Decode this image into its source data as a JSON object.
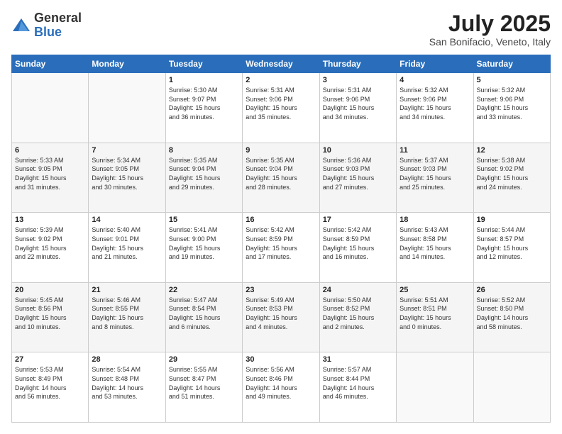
{
  "logo": {
    "general": "General",
    "blue": "Blue"
  },
  "header": {
    "month": "July 2025",
    "location": "San Bonifacio, Veneto, Italy"
  },
  "days_of_week": [
    "Sunday",
    "Monday",
    "Tuesday",
    "Wednesday",
    "Thursday",
    "Friday",
    "Saturday"
  ],
  "weeks": [
    [
      {
        "day": "",
        "info": ""
      },
      {
        "day": "",
        "info": ""
      },
      {
        "day": "1",
        "info": "Sunrise: 5:30 AM\nSunset: 9:07 PM\nDaylight: 15 hours\nand 36 minutes."
      },
      {
        "day": "2",
        "info": "Sunrise: 5:31 AM\nSunset: 9:06 PM\nDaylight: 15 hours\nand 35 minutes."
      },
      {
        "day": "3",
        "info": "Sunrise: 5:31 AM\nSunset: 9:06 PM\nDaylight: 15 hours\nand 34 minutes."
      },
      {
        "day": "4",
        "info": "Sunrise: 5:32 AM\nSunset: 9:06 PM\nDaylight: 15 hours\nand 34 minutes."
      },
      {
        "day": "5",
        "info": "Sunrise: 5:32 AM\nSunset: 9:06 PM\nDaylight: 15 hours\nand 33 minutes."
      }
    ],
    [
      {
        "day": "6",
        "info": "Sunrise: 5:33 AM\nSunset: 9:05 PM\nDaylight: 15 hours\nand 31 minutes."
      },
      {
        "day": "7",
        "info": "Sunrise: 5:34 AM\nSunset: 9:05 PM\nDaylight: 15 hours\nand 30 minutes."
      },
      {
        "day": "8",
        "info": "Sunrise: 5:35 AM\nSunset: 9:04 PM\nDaylight: 15 hours\nand 29 minutes."
      },
      {
        "day": "9",
        "info": "Sunrise: 5:35 AM\nSunset: 9:04 PM\nDaylight: 15 hours\nand 28 minutes."
      },
      {
        "day": "10",
        "info": "Sunrise: 5:36 AM\nSunset: 9:03 PM\nDaylight: 15 hours\nand 27 minutes."
      },
      {
        "day": "11",
        "info": "Sunrise: 5:37 AM\nSunset: 9:03 PM\nDaylight: 15 hours\nand 25 minutes."
      },
      {
        "day": "12",
        "info": "Sunrise: 5:38 AM\nSunset: 9:02 PM\nDaylight: 15 hours\nand 24 minutes."
      }
    ],
    [
      {
        "day": "13",
        "info": "Sunrise: 5:39 AM\nSunset: 9:02 PM\nDaylight: 15 hours\nand 22 minutes."
      },
      {
        "day": "14",
        "info": "Sunrise: 5:40 AM\nSunset: 9:01 PM\nDaylight: 15 hours\nand 21 minutes."
      },
      {
        "day": "15",
        "info": "Sunrise: 5:41 AM\nSunset: 9:00 PM\nDaylight: 15 hours\nand 19 minutes."
      },
      {
        "day": "16",
        "info": "Sunrise: 5:42 AM\nSunset: 8:59 PM\nDaylight: 15 hours\nand 17 minutes."
      },
      {
        "day": "17",
        "info": "Sunrise: 5:42 AM\nSunset: 8:59 PM\nDaylight: 15 hours\nand 16 minutes."
      },
      {
        "day": "18",
        "info": "Sunrise: 5:43 AM\nSunset: 8:58 PM\nDaylight: 15 hours\nand 14 minutes."
      },
      {
        "day": "19",
        "info": "Sunrise: 5:44 AM\nSunset: 8:57 PM\nDaylight: 15 hours\nand 12 minutes."
      }
    ],
    [
      {
        "day": "20",
        "info": "Sunrise: 5:45 AM\nSunset: 8:56 PM\nDaylight: 15 hours\nand 10 minutes."
      },
      {
        "day": "21",
        "info": "Sunrise: 5:46 AM\nSunset: 8:55 PM\nDaylight: 15 hours\nand 8 minutes."
      },
      {
        "day": "22",
        "info": "Sunrise: 5:47 AM\nSunset: 8:54 PM\nDaylight: 15 hours\nand 6 minutes."
      },
      {
        "day": "23",
        "info": "Sunrise: 5:49 AM\nSunset: 8:53 PM\nDaylight: 15 hours\nand 4 minutes."
      },
      {
        "day": "24",
        "info": "Sunrise: 5:50 AM\nSunset: 8:52 PM\nDaylight: 15 hours\nand 2 minutes."
      },
      {
        "day": "25",
        "info": "Sunrise: 5:51 AM\nSunset: 8:51 PM\nDaylight: 15 hours\nand 0 minutes."
      },
      {
        "day": "26",
        "info": "Sunrise: 5:52 AM\nSunset: 8:50 PM\nDaylight: 14 hours\nand 58 minutes."
      }
    ],
    [
      {
        "day": "27",
        "info": "Sunrise: 5:53 AM\nSunset: 8:49 PM\nDaylight: 14 hours\nand 56 minutes."
      },
      {
        "day": "28",
        "info": "Sunrise: 5:54 AM\nSunset: 8:48 PM\nDaylight: 14 hours\nand 53 minutes."
      },
      {
        "day": "29",
        "info": "Sunrise: 5:55 AM\nSunset: 8:47 PM\nDaylight: 14 hours\nand 51 minutes."
      },
      {
        "day": "30",
        "info": "Sunrise: 5:56 AM\nSunset: 8:46 PM\nDaylight: 14 hours\nand 49 minutes."
      },
      {
        "day": "31",
        "info": "Sunrise: 5:57 AM\nSunset: 8:44 PM\nDaylight: 14 hours\nand 46 minutes."
      },
      {
        "day": "",
        "info": ""
      },
      {
        "day": "",
        "info": ""
      }
    ]
  ]
}
